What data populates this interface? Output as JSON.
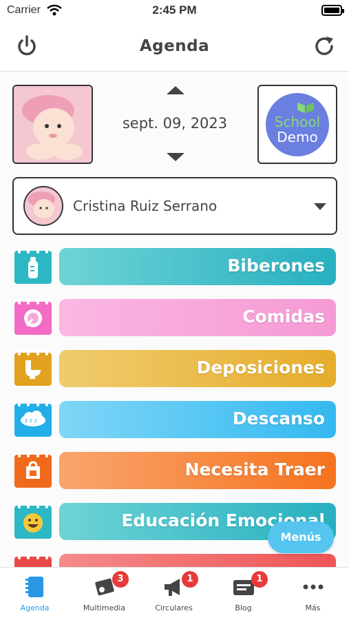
{
  "status_bar": {
    "carrier": "Carrier",
    "time": "2:45 PM"
  },
  "header": {
    "title": "Agenda",
    "left_icon": "power-icon",
    "right_icon": "refresh-icon"
  },
  "date": {
    "text": "sept. 09, 2023"
  },
  "school": {
    "line1": "School",
    "line2": "Demo"
  },
  "child": {
    "name": "Cristina Ruiz Serrano"
  },
  "categories": [
    {
      "label": "Biberones",
      "icon": "bottle-icon",
      "color": "#2cb7c4"
    },
    {
      "label": "Comidas",
      "icon": "plate-icon",
      "color": "#f59ad5"
    },
    {
      "label": "Deposiciones",
      "icon": "toilet-icon",
      "color": "#e8b23a"
    },
    {
      "label": "Descanso",
      "icon": "cloud-sleep-icon",
      "color": "#3dbdf3"
    },
    {
      "label": "Necesita Traer",
      "icon": "bag-icon",
      "color": "#f7782a"
    },
    {
      "label": "Educación Emocional",
      "icon": "smile-icon",
      "color": "#2cb7c4"
    },
    {
      "label": "",
      "icon": "calendar-icon",
      "color": "#f05a5a"
    }
  ],
  "menus_button": {
    "label": "Menús"
  },
  "tabs": [
    {
      "label": "Agenda",
      "icon": "agenda-icon",
      "badge": ""
    },
    {
      "label": "Multimedia",
      "icon": "multimedia-icon",
      "badge": "3"
    },
    {
      "label": "Circulares",
      "icon": "megaphone-icon",
      "badge": "1"
    },
    {
      "label": "Blog",
      "icon": "blog-icon",
      "badge": "1"
    },
    {
      "label": "Más",
      "icon": "more-icon",
      "badge": ""
    }
  ]
}
